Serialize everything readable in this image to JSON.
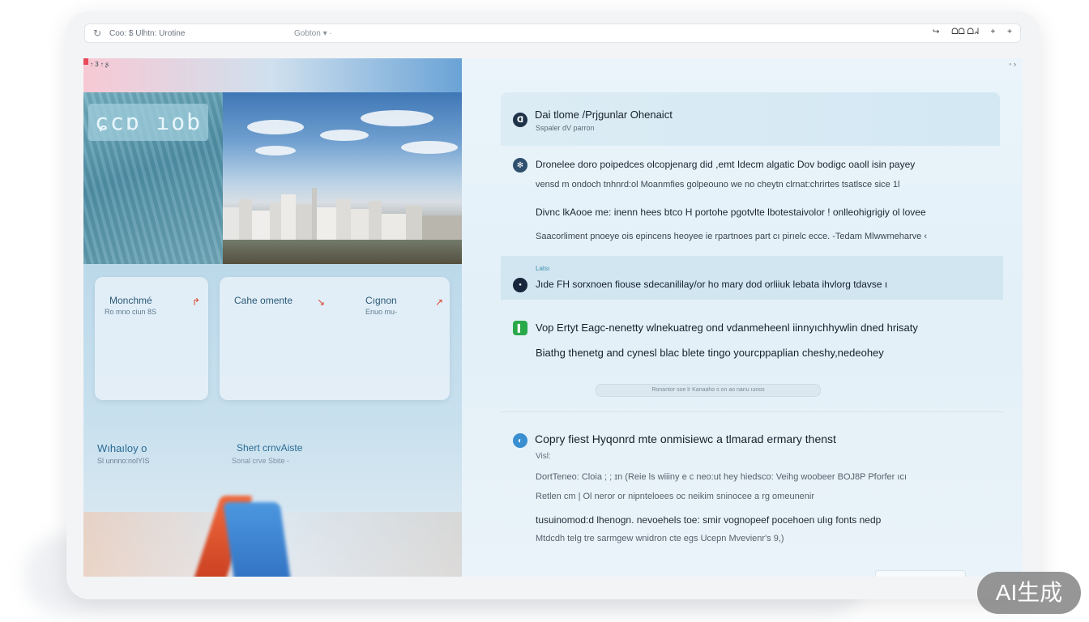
{
  "browser": {
    "url": "Coo: $ Ulhtn: Urotine",
    "center_text": "Gobton ▾ ·",
    "controls": [
      "↪",
      "ᗝᗝ ᗝᖽ",
      "+",
      "+"
    ]
  },
  "left": {
    "mini_bar": "↑ 3 ↑ ʂ",
    "sign_text": "ɕcɒ ıob",
    "cards": [
      {
        "title": "Monchmé",
        "subtitle": "Ro mno ciun 8S",
        "glyph": "↱"
      },
      {
        "title": "Cahe omente",
        "subtitle": "",
        "glyph": "↘"
      },
      {
        "title": "Cıgnon",
        "subtitle": "Enuo mu-",
        "glyph": "↗"
      }
    ],
    "label_one": "Wıhaıloy o",
    "label_one_sub": "Sl unnno:nolYIS",
    "label_two": "Shert crnvAiste",
    "label_two_sub": "Sonal crve Sbite -"
  },
  "right": {
    "corner": "◦ ›",
    "header": {
      "title": "Dai tlome /Prjgunlar  Ohenaict",
      "subtitle": "Sspaler dV parron",
      "icon": "ᗡ"
    },
    "section1": {
      "icon": "✻",
      "line1": "Dronelee doro poipedces olcopjenarg did ,emt Idecm algatic Dov bodigc oaoll isin payey",
      "line2": "vensd m ondoch tnhnrd:ol Moanmfies golpeouno  we no cheytn clrnat:chrirtes tsatlsce sice 1l",
      "line3": "Divnc lkAooe me: inenn hees btco H portohe pgotvlte lbotestaivolor !  onlleohigrigiy ol lovee",
      "line4": "Saacorliment pnoeye ois epincens heoyee ie rpartnoes  part cı pirıelc ecce. -Tedam Mlwwmeharve  ‹"
    },
    "highlight": {
      "kicker": "Latsı",
      "text": "Jıde FH sorxnoen fiouse sdecanililay/or ho mary dod orliiuk lebata ihvlorg tdavse  ı",
      "icon": "●"
    },
    "section2": {
      "icon": "▌",
      "line1": "Vop Ertyt Eagc-nenetty wlnekuatreg ond vdanmeheenl iinnyıchhywlin dned hrisaty",
      "line2": "Biathg thenetg and cynesl blac blete tinɡo  yourcppaplian cheshy,nedeohey",
      "pill": "Ronantor soe lr Kanaaho s on ao nanu ıunos"
    },
    "section3": {
      "icon": "◐",
      "title": "Copry fiest Hyqonrd mte onmisiewc a tlmarad ermary thenst",
      "kicker": "Visl:",
      "line1": "DortTeneo: Cloia ;  ; ɪn (Reie ls wiiiny e c neo:ut hey hiedsco: Veihg woobeer  BOJ8P Pforfer ıcı",
      "line2": "Retlen cm | Ol neror or nipnteloees oc neikim sninocee a rg omeunenir",
      "line3": "tusuinomod:d lhenogn. nevoehels toe: smir vognopeef pocehoen ulıg fonts  nedp",
      "line4": "Mtdcdh telg tre sarmgew wnidron cte egs Ucepn  Mvevienr's 9,)"
    }
  },
  "watermark": "AI生成",
  "colors": {
    "accent_blue": "#2a6b93",
    "icon_navy": "#1f3348",
    "icon_green": "#2aa84a",
    "icon_teal": "#3a8fd0",
    "panel_bg": "#e8f2f8"
  }
}
